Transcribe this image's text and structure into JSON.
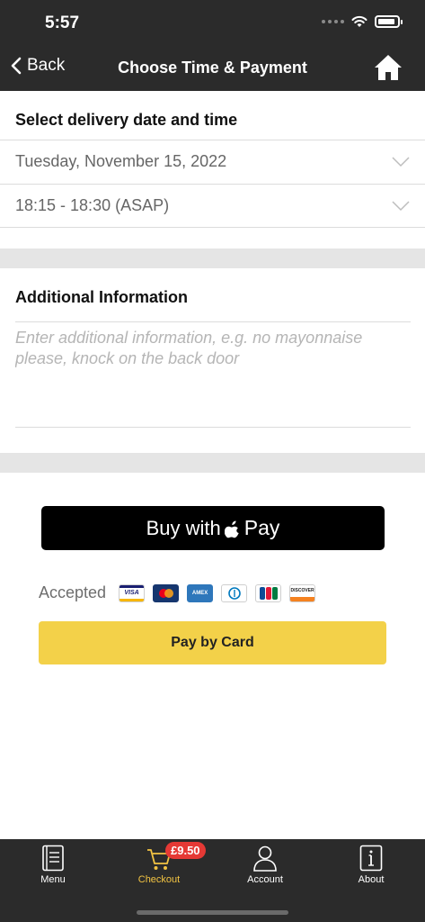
{
  "status_bar": {
    "time": "5:57"
  },
  "nav": {
    "back_label": "Back",
    "title": "Choose Time & Payment"
  },
  "delivery": {
    "heading": "Select delivery date and time",
    "date_value": "Tuesday, November 15, 2022",
    "time_value": "18:15 - 18:30 (ASAP)"
  },
  "additional": {
    "heading": "Additional Information",
    "placeholder": "Enter additional information, e.g. no mayonnaise please, knock on the back door"
  },
  "payment": {
    "apple_pay_prefix": "Buy with",
    "apple_pay_word": "Pay",
    "accepted_label": "Accepted",
    "cards": [
      "VISA",
      "MC",
      "AMEX",
      "DINERS",
      "JCB",
      "DISCOVER"
    ],
    "pay_by_card_label": "Pay by Card"
  },
  "tabbar": {
    "tabs": [
      {
        "label": "Menu",
        "icon": "menu-book-icon"
      },
      {
        "label": "Checkout",
        "icon": "cart-icon",
        "badge": "£9.50",
        "active": true
      },
      {
        "label": "Account",
        "icon": "person-icon"
      },
      {
        "label": "About",
        "icon": "info-icon"
      }
    ]
  },
  "colors": {
    "accent": "#f3d149",
    "active_tab": "#f3c443",
    "badge": "#e53935",
    "bar": "#2b2b2b"
  }
}
